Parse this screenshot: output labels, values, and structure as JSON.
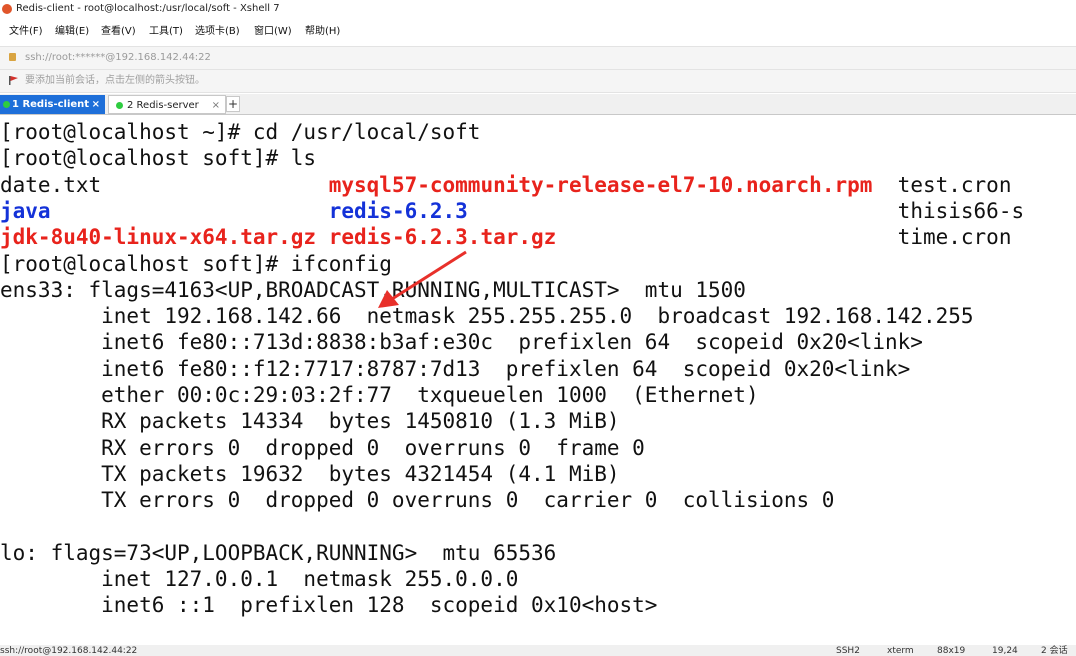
{
  "window": {
    "title": "Redis-client - root@localhost:/usr/local/soft - Xshell 7"
  },
  "menu": [
    "文件(F)",
    "编辑(E)",
    "查看(V)",
    "工具(T)",
    "选项卡(B)",
    "窗口(W)",
    "帮助(H)"
  ],
  "address": {
    "value": "ssh://root:******@192.168.142.44:22"
  },
  "info": {
    "text": "要添加当前会话，点击左侧的箭头按钮。"
  },
  "tabs": [
    {
      "label": "1 Redis-client",
      "close": "×",
      "active": true
    },
    {
      "label": "2 Redis-server",
      "close": "×",
      "active": false
    }
  ],
  "new_tab": "+",
  "terminal": {
    "lines": [
      [
        {
          "t": "[root@localhost ~]# cd /usr/local/soft"
        }
      ],
      [
        {
          "t": "[root@localhost soft]# ls"
        }
      ],
      [
        {
          "t": "date.txt                  "
        },
        {
          "t": "mysql57-community-release-el7-10.noarch.rpm",
          "c": "red"
        },
        {
          "t": "  test.cron"
        }
      ],
      [
        {
          "t": "java",
          "c": "blue"
        },
        {
          "t": "                      "
        },
        {
          "t": "redis-6.2.3",
          "c": "blue"
        },
        {
          "t": "                                  thisis66-s"
        }
      ],
      [
        {
          "t": "jdk-8u40-linux-x64.tar.gz",
          "c": "red"
        },
        {
          "t": " "
        },
        {
          "t": "redis-6.2.3.tar.gz",
          "c": "red"
        },
        {
          "t": "                           time.cron"
        }
      ],
      [
        {
          "t": "[root@localhost soft]# ifconfig"
        }
      ],
      [
        {
          "t": "ens33: flags=4163<UP,BROADCAST,RUNNING,MULTICAST>  mtu 1500"
        }
      ],
      [
        {
          "t": "        inet 192.168.142.66  netmask 255.255.255.0  broadcast 192.168.142.255"
        }
      ],
      [
        {
          "t": "        inet6 fe80::713d:8838:b3af:e30c  prefixlen 64  scopeid 0x20<link>"
        }
      ],
      [
        {
          "t": "        inet6 fe80::f12:7717:8787:7d13  prefixlen 64  scopeid 0x20<link>"
        }
      ],
      [
        {
          "t": "        ether 00:0c:29:03:2f:77  txqueuelen 1000  (Ethernet)"
        }
      ],
      [
        {
          "t": "        RX packets 14334  bytes 1450810 (1.3 MiB)"
        }
      ],
      [
        {
          "t": "        RX errors 0  dropped 0  overruns 0  frame 0"
        }
      ],
      [
        {
          "t": "        TX packets 19632  bytes 4321454 (4.1 MiB)"
        }
      ],
      [
        {
          "t": "        TX errors 0  dropped 0 overruns 0  carrier 0  collisions 0"
        }
      ],
      [
        {
          "t": ""
        }
      ],
      [
        {
          "t": "lo: flags=73<UP,LOOPBACK,RUNNING>  mtu 65536"
        }
      ],
      [
        {
          "t": "        inet 127.0.0.1  netmask 255.0.0.0"
        }
      ],
      [
        {
          "t": "        inet6 ::1  prefixlen 128  scopeid 0x10<host>"
        }
      ]
    ]
  },
  "status": {
    "connection": "ssh://root@192.168.142.44:22",
    "protocol": "SSH2",
    "term": "xterm",
    "size": "88x19",
    "cursor": "19,24",
    "sessions": "2 会话"
  },
  "colors": {
    "red": "#e8231c",
    "blue": "#1432d8",
    "tab_active": "#1e6fd9",
    "arrow": "#e8302a"
  }
}
